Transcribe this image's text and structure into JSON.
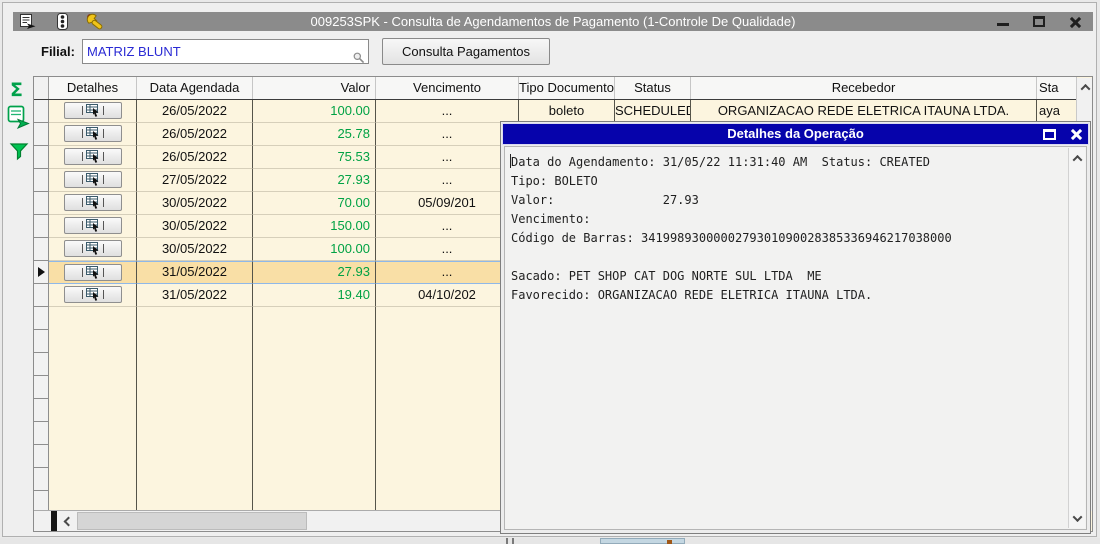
{
  "window": {
    "title": "009253SPK - Consulta de Agendamentos de Pagamento (1-Controle De Qualidade)"
  },
  "filter": {
    "label": "Filial:",
    "value": "MATRIZ BLUNT",
    "button_label": "Consulta Pagamentos"
  },
  "grid": {
    "columns": [
      "Detalhes",
      "Data Agendada",
      "Valor",
      "Vencimento",
      "Tipo Documento",
      "Status",
      "Recebedor",
      "Sta"
    ],
    "rows": [
      {
        "data_agendada": "26/05/2022",
        "valor": "100.00",
        "vencimento": "...",
        "tipo_documento": "boleto",
        "status": "SCHEDULED",
        "recebedor": "ORGANIZACAO REDE ELETRICA ITAUNA LTDA.",
        "sta": "aya",
        "selected": false
      },
      {
        "data_agendada": "26/05/2022",
        "valor": "25.78",
        "vencimento": "...",
        "tipo_documento": "",
        "status": "",
        "recebedor": "",
        "sta": "",
        "selected": false
      },
      {
        "data_agendada": "26/05/2022",
        "valor": "75.53",
        "vencimento": "...",
        "tipo_documento": "",
        "status": "",
        "recebedor": "",
        "sta": "",
        "selected": false
      },
      {
        "data_agendada": "27/05/2022",
        "valor": "27.93",
        "vencimento": "...",
        "tipo_documento": "",
        "status": "",
        "recebedor": "",
        "sta": "",
        "selected": false
      },
      {
        "data_agendada": "30/05/2022",
        "valor": "70.00",
        "vencimento": "05/09/201",
        "tipo_documento": "",
        "status": "",
        "recebedor": "",
        "sta": "",
        "selected": false
      },
      {
        "data_agendada": "30/05/2022",
        "valor": "150.00",
        "vencimento": "...",
        "tipo_documento": "",
        "status": "",
        "recebedor": "",
        "sta": "",
        "selected": false
      },
      {
        "data_agendada": "30/05/2022",
        "valor": "100.00",
        "vencimento": "...",
        "tipo_documento": "",
        "status": "",
        "recebedor": "",
        "sta": "",
        "selected": false
      },
      {
        "data_agendada": "31/05/2022",
        "valor": "27.93",
        "vencimento": "...",
        "tipo_documento": "",
        "status": "",
        "recebedor": "",
        "sta": "",
        "selected": true
      },
      {
        "data_agendada": "31/05/2022",
        "valor": "19.40",
        "vencimento": "04/10/202",
        "tipo_documento": "",
        "status": "",
        "recebedor": "",
        "sta": "",
        "selected": false
      }
    ],
    "empty_indicator_rows": 9
  },
  "dialog": {
    "title": "Detalhes da Operação",
    "lines": [
      "Data do Agendamento: 31/05/22 11:31:40 AM  Status: CREATED",
      "Tipo: BOLETO",
      "Valor:               27.93",
      "Vencimento:",
      "Código de Barras: 3419989300000279301090028385336946217038000",
      "",
      "Sacado: PET SHOP CAT DOG NORTE SUL LTDA  ME",
      "Favorecido: ORGANIZACAO REDE ELETRICA ITAUNA LTDA."
    ]
  },
  "colors": {
    "titlebar_bg": "#8B8B8B",
    "dialog_title_bg": "#0603AB",
    "row_bg": "#FCF5DF",
    "selection_bg": "#F9DFA6",
    "selection_border": "#8FB8E8",
    "value_green": "#00A244",
    "accent_green": "#00A14B",
    "input_text_blue": "#2A2AD4"
  }
}
